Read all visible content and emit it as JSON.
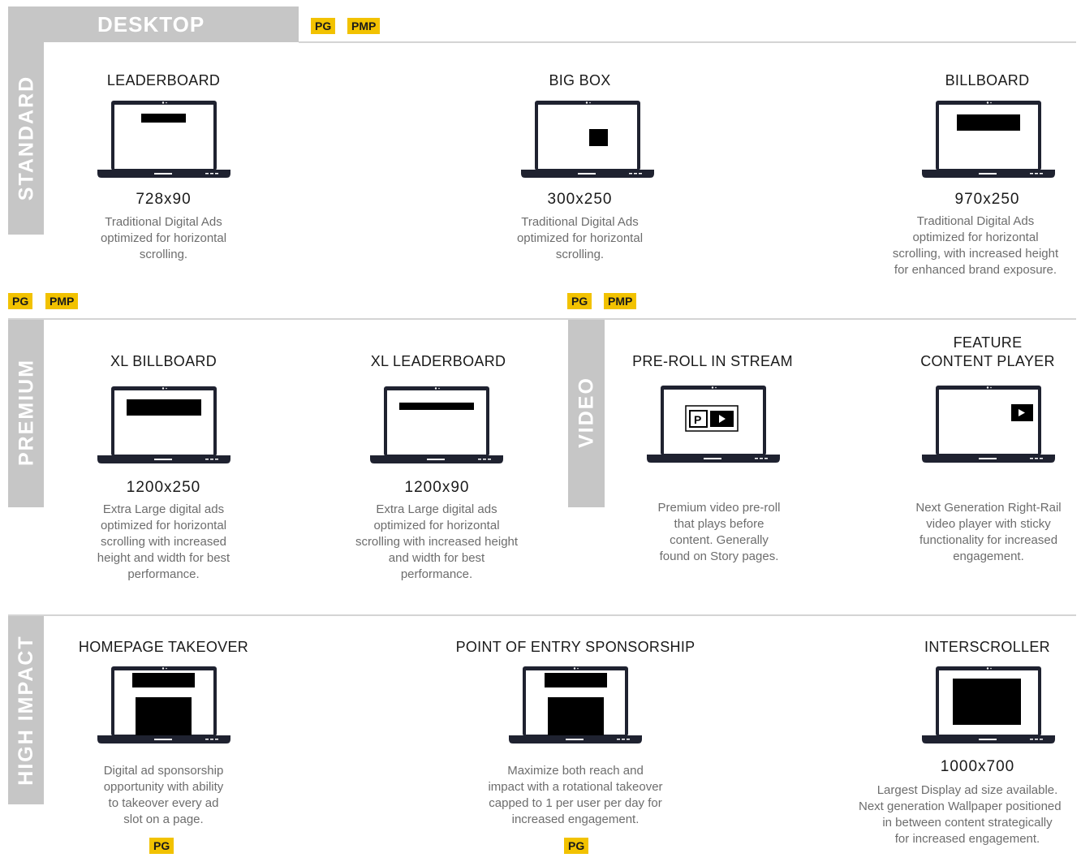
{
  "header": {
    "title": "DESKTOP",
    "badges": [
      "PG",
      "PMP"
    ]
  },
  "colors": {
    "band": "#c6c6c6",
    "badge": "#f2c200",
    "laptop": "#1f2230",
    "ad": "#000000"
  },
  "sections": {
    "standard": {
      "label": "STANDARD",
      "items": [
        {
          "title": "LEADERBOARD",
          "size": "728x90",
          "desc": [
            "Traditional Digital Ads",
            "optimized for horizontal",
            "scrolling."
          ]
        },
        {
          "title": "BIG BOX",
          "size": "300x250",
          "desc": [
            "Traditional Digital Ads",
            "optimized for horizontal",
            "scrolling."
          ]
        },
        {
          "title": "BILLBOARD",
          "size": "970x250",
          "desc": [
            "Traditional Digital Ads",
            "optimized for horizontal",
            "scrolling, with increased height",
            "for enhanced brand exposure."
          ]
        }
      ]
    },
    "premium": {
      "label": "PREMIUM",
      "badges": [
        "PG",
        "PMP"
      ],
      "items": [
        {
          "title": "XL BILLBOARD",
          "size": "1200x250",
          "desc": [
            "Extra Large digital ads",
            "optimized for horizontal",
            "scrolling with increased",
            "height and width for best",
            "performance."
          ]
        },
        {
          "title": "XL LEADERBOARD",
          "size": "1200x90",
          "desc": [
            "Extra Large digital ads",
            "optimized for horizontal",
            "scrolling with increased height",
            "and width for best",
            "performance."
          ]
        }
      ]
    },
    "video": {
      "label": "VIDEO",
      "badges": [
        "PG",
        "PMP"
      ],
      "items": [
        {
          "title": "PRE-ROLL IN STREAM",
          "desc": [
            "Premium video pre-roll",
            "that plays before",
            "content. Generally",
            "found on Story pages."
          ]
        },
        {
          "title_lines": [
            "FEATURE",
            "CONTENT PLAYER"
          ],
          "desc": [
            "Next Generation Right-Rail",
            "video player with sticky",
            "functionality for increased",
            "engagement."
          ]
        }
      ]
    },
    "high_impact": {
      "label": "HIGH IMPACT",
      "items": [
        {
          "title": "HOMEPAGE TAKEOVER",
          "desc": [
            "Digital ad sponsorship",
            "opportunity with ability",
            "to takeover every ad",
            "slot on a page."
          ],
          "badge": "PG"
        },
        {
          "title": "POINT OF ENTRY SPONSORSHIP",
          "desc": [
            "Maximize both reach and",
            "impact with a rotational takeover",
            "capped to 1 per user per day for",
            "increased engagement."
          ],
          "badge": "PG"
        },
        {
          "title": "INTERSCROLLER",
          "size": "1000x700",
          "desc": [
            "Largest Display ad size available.",
            "Next generation Wallpaper positioned",
            "in between content strategically",
            "for increased engagement."
          ]
        }
      ]
    }
  }
}
